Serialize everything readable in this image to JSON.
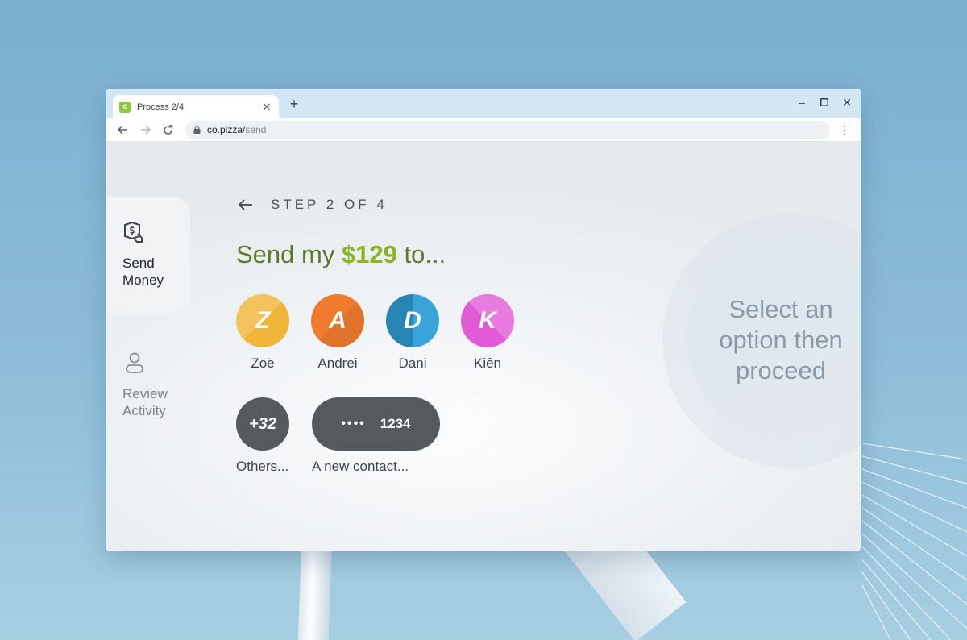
{
  "browser": {
    "tab_title": "Process 2/4",
    "favicon_letter": "c",
    "new_tab_label": "+",
    "url_host": "co.pizza/",
    "url_path": "send"
  },
  "sidenav": {
    "items": [
      {
        "label_line1": "Send",
        "label_line2": "Money",
        "icon": "money-transfer-icon",
        "active": true
      },
      {
        "label_line1": "Review",
        "label_line2": "Activity",
        "icon": "user-icon",
        "active": false
      }
    ]
  },
  "step": {
    "label": "STEP 2 OF 4"
  },
  "headline": {
    "prefix": "Send my ",
    "amount": "$129",
    "suffix": " to..."
  },
  "contacts": [
    {
      "name": "Zoë",
      "initial": "Z",
      "color": "#f0b63a"
    },
    {
      "name": "Andrei",
      "initial": "A",
      "color": "#f07a2e"
    },
    {
      "name": "Dani",
      "initial": "D",
      "color": "#2f9fd6"
    },
    {
      "name": "Kiên",
      "initial": "K",
      "color": "#e25ad6"
    }
  ],
  "others": {
    "count": "+32",
    "label": "Others..."
  },
  "new_contact": {
    "masked": "••••",
    "last4": "1234",
    "label": "A new contact..."
  },
  "proceed": {
    "text": "Select an option then proceed"
  },
  "colors": {
    "accent_green": "#8db51d",
    "headline_green": "#5d7a2a",
    "dark_button": "#545a5e"
  }
}
